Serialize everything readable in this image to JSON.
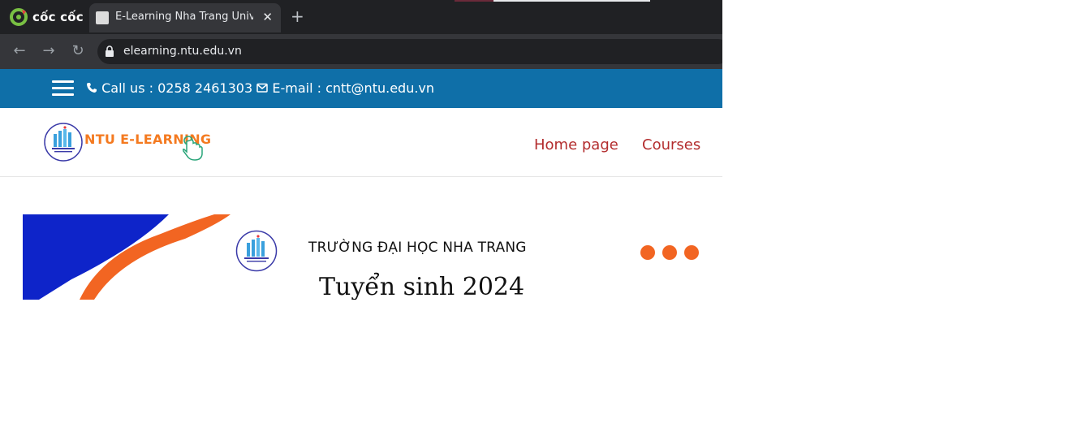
{
  "browser": {
    "brand_name": "cốc cốc",
    "tab_title": "E-Learning Nha Trang University",
    "url": "elearning.ntu.edu.vn"
  },
  "page": {
    "contact": {
      "phone_text": "Call us : 0258 2461303",
      "email_text": "E-mail : cntt@ntu.edu.vn"
    },
    "logo_text": "NTU E-LEARNING",
    "nav": [
      "Home page",
      "Courses"
    ],
    "banner": {
      "school": "TRƯỜNG ĐẠI HỌC NHA TRANG",
      "title": "Tuyển sinh 2024"
    }
  },
  "colors": {
    "contact_bar": "#0f6fa8",
    "nav_link": "#b32d2e",
    "accent_orange": "#f26522",
    "banner_blue": "#0e24c9"
  }
}
